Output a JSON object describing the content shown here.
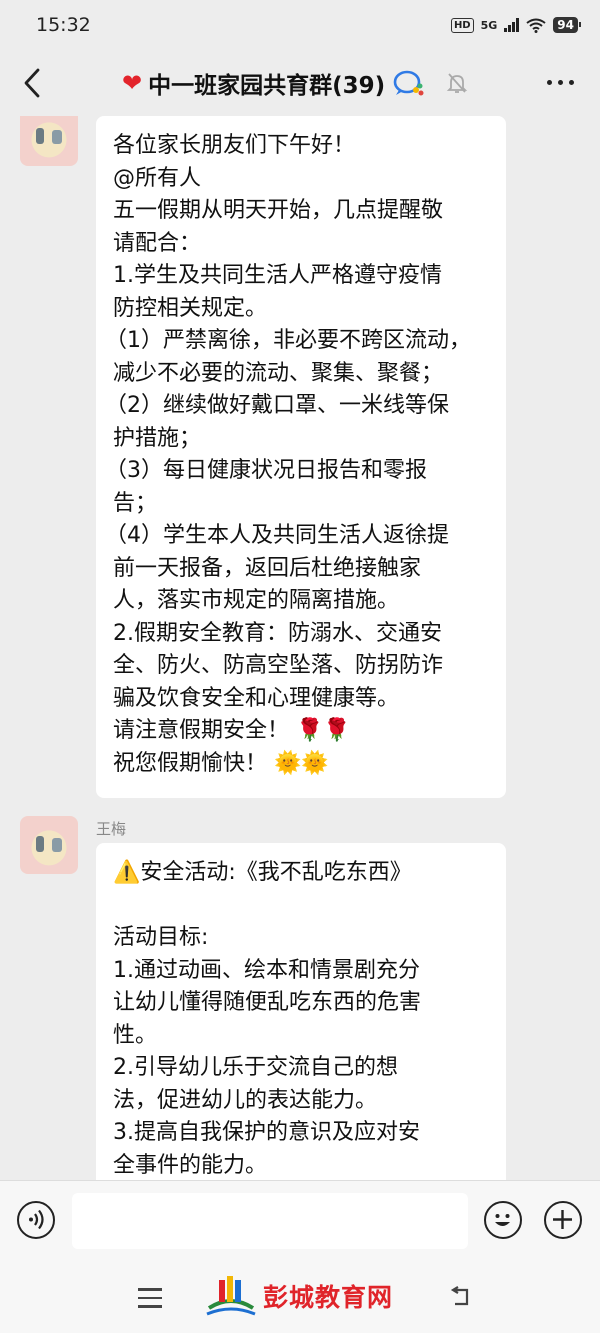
{
  "status_bar": {
    "time": "15:32",
    "hd": "HD",
    "network": "5G",
    "battery": "94"
  },
  "nav": {
    "title": "中一班家园共育群(39)"
  },
  "messages": [
    {
      "sender": "",
      "lines": [
        "各位家长朋友们下午好！",
        "@所有人",
        "五一假期从明天开始，几点提醒敬",
        "请配合：",
        "1.学生及共同生活人严格遵守疫情",
        "防控相关规定。",
        "（1）严禁离徐，非必要不跨区流动，",
        "减少不必要的流动、聚集、聚餐；",
        "（2）继续做好戴口罩、一米线等保",
        "护措施；",
        "（3）每日健康状况日报告和零报",
        "告；",
        "（4）学生本人及共同生活人返徐提",
        "前一天报备，返回后杜绝接触家",
        "人，落实市规定的隔离措施。",
        "2.假期安全教育：防溺水、交通安",
        "全、防火、防高空坠落、防拐防诈",
        "骗及饮食安全和心理健康等。",
        "请注意假期安全！ 🌹🌹",
        "祝您假期愉快！ 🌞🌞"
      ]
    },
    {
      "sender": "王梅",
      "lines": [
        "⚠️安全活动:《我不乱吃东西》",
        "",
        "活动目标:",
        "1.通过动画、绘本和情景剧充分",
        "让幼儿懂得随便乱吃东西的危害",
        "性。",
        "2.引导幼儿乐于交流自己的想",
        "法，促进幼儿的表达能力。",
        "3.提高自我保护的意识及应对安",
        "全事件的能力。"
      ]
    }
  ],
  "input": {
    "placeholder": ""
  },
  "watermark": {
    "text": "彭城教育网"
  }
}
